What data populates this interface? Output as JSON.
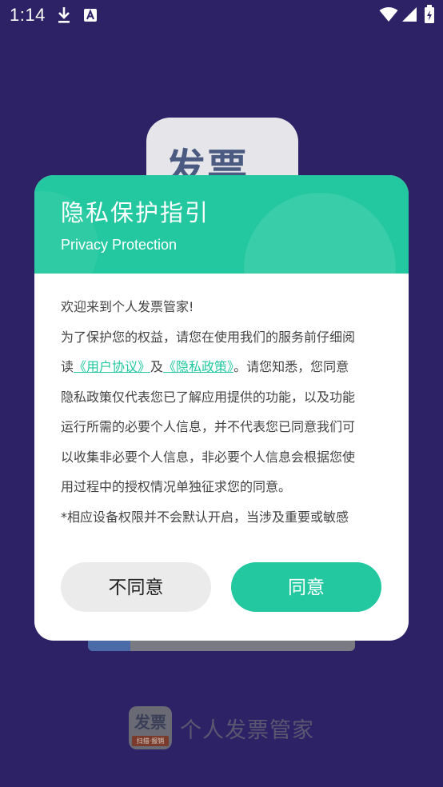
{
  "status_bar": {
    "time": "1:14",
    "icons": [
      "download-icon",
      "a-notification-icon",
      "wifi-icon",
      "cellular-signal-icon",
      "battery-icon"
    ]
  },
  "background": {
    "splash_tile_text": "发票",
    "app_name": "个人发票管家",
    "logo_main_text": "发票",
    "logo_sub_text": "扫描·报销"
  },
  "dialog": {
    "title": "隐私保护指引",
    "subtitle": "Privacy Protection",
    "body": {
      "line1": "欢迎来到个人发票管家!",
      "line2": "为了保护您的权益，请您在使用我们的服务前仔细阅",
      "line3_prefix": "读",
      "user_agreement_link": "《用户协议》",
      "line3_and": "及",
      "privacy_policy_link": "《隐私政策》",
      "line3_suffix": "。请您知悉，您同意",
      "line4": "隐私政策仅代表您已了解应用提供的功能，以及功能",
      "line5": "运行所需的必要个人信息，并不代表您已同意我们可",
      "line6": "以收集非必要个人信息，非必要个人信息会根据您使",
      "line7": "用过程中的授权情况单独征求您的同意。",
      "line8": "*相应设备权限并不会默认开启，当涉及重要或敏感"
    },
    "disagree_label": "不同意",
    "agree_label": "同意"
  },
  "colors": {
    "background": "#2e2266",
    "accent": "#23c8a0",
    "disagree_button": "#ebebeb"
  }
}
